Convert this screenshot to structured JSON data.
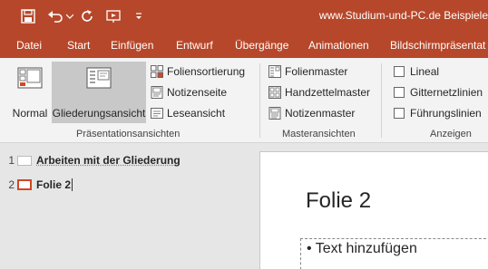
{
  "title_bar": {
    "document_title": "www.Studium-und-PC.de  Beispiele",
    "quick_access": [
      "save-icon",
      "undo-icon",
      "undo-dropdown-icon",
      "redo-icon",
      "start-from-beginning-icon",
      "customize-qat-icon"
    ]
  },
  "tabs": [
    {
      "label": "Datei"
    },
    {
      "label": "Start"
    },
    {
      "label": "Einfügen"
    },
    {
      "label": "Entwurf"
    },
    {
      "label": "Übergänge"
    },
    {
      "label": "Animationen"
    },
    {
      "label": "Bildschirmpräsentat"
    }
  ],
  "ribbon": {
    "presentation_views": {
      "label": "Präsentationsansichten",
      "normal": "Normal",
      "outline": "Gliederungsansicht",
      "slide_sorter": "Foliensortierung",
      "notes_page": "Notizenseite",
      "reading_view": "Leseansicht"
    },
    "master_views": {
      "label": "Masteransichten",
      "slide_master": "Folienmaster",
      "handout_master": "Handzettelmaster",
      "notes_master": "Notizenmaster"
    },
    "show": {
      "label": "Anzeigen",
      "ruler": "Lineal",
      "gridlines": "Gitternetzlinien",
      "guides": "Führungslinien"
    }
  },
  "outline": {
    "items": [
      {
        "number": "1",
        "text": "Arbeiten mit der Gliederung"
      },
      {
        "number": "2",
        "text": "Folie 2"
      }
    ]
  },
  "slide": {
    "title": "Folie 2",
    "content_placeholder": "• Text hinzufügen"
  },
  "colors": {
    "accent": "#b7472a",
    "selected_thumb": "#d24726"
  }
}
